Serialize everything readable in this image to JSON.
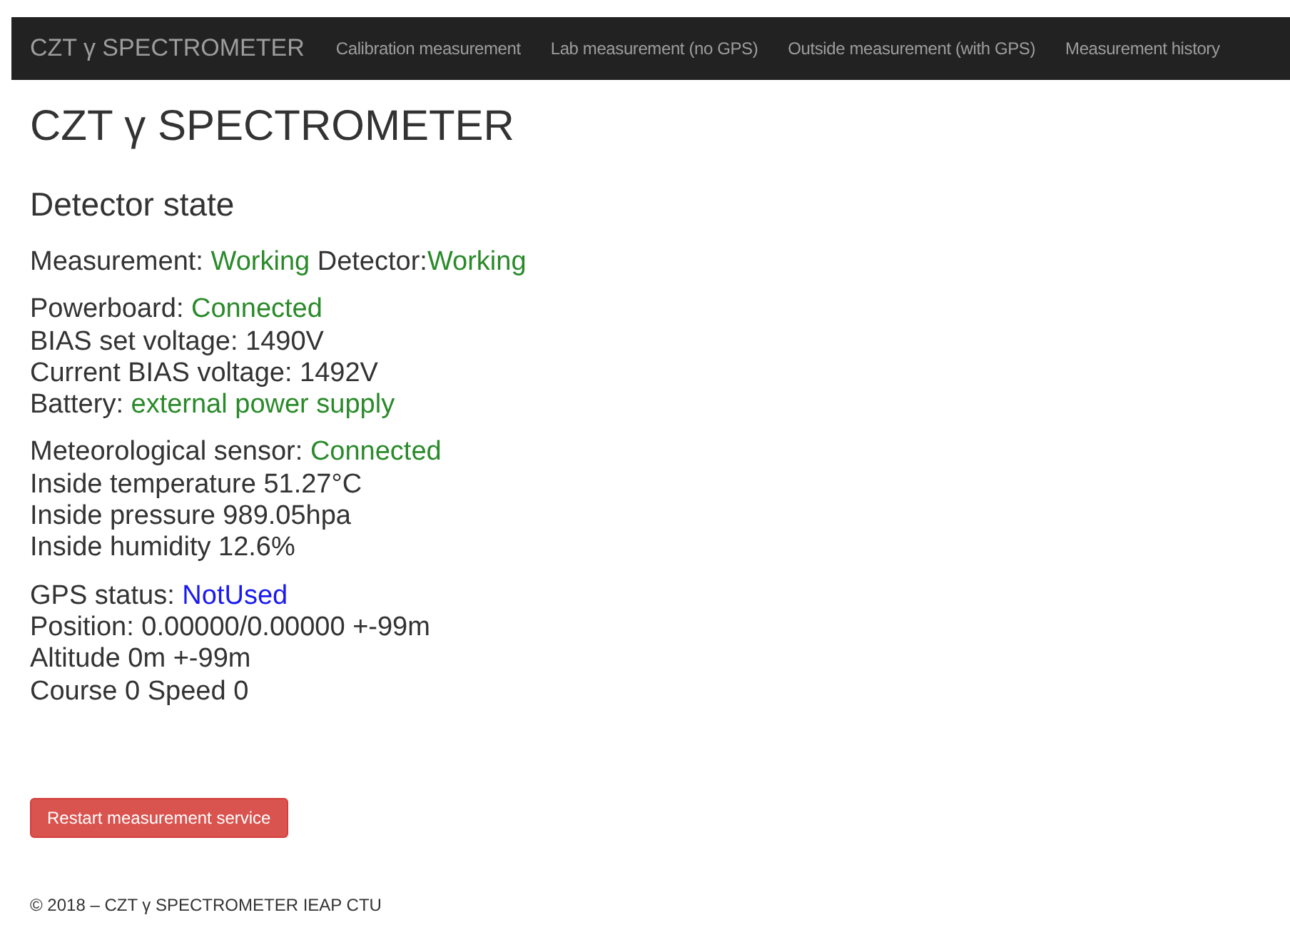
{
  "navbar": {
    "brand": "CZT γ SPECTROMETER",
    "links": [
      {
        "label": "Calibration measurement"
      },
      {
        "label": "Lab measurement (no GPS)"
      },
      {
        "label": "Outside measurement (with GPS)"
      },
      {
        "label": "Measurement history"
      }
    ]
  },
  "title": "CZT γ SPECTROMETER",
  "section_title": "Detector state",
  "groups": [
    {
      "lines": [
        {
          "segments": [
            {
              "text": "Measurement: "
            },
            {
              "text": "Working",
              "color": "#2a8a2a"
            },
            {
              "text": " Detector:"
            },
            {
              "text": "Working",
              "color": "#2a8a2a"
            }
          ]
        }
      ]
    },
    {
      "lines": [
        {
          "segments": [
            {
              "text": "Powerboard: "
            },
            {
              "text": "Connected",
              "color": "#2a8a2a"
            }
          ]
        },
        {
          "segments": [
            {
              "text": "BIAS set voltage: 1490V"
            }
          ]
        },
        {
          "segments": [
            {
              "text": "Current BIAS voltage: 1492V"
            }
          ]
        },
        {
          "segments": [
            {
              "text": "Battery: "
            },
            {
              "text": "external power supply",
              "color": "#2a8a2a"
            }
          ]
        }
      ]
    },
    {
      "lines": [
        {
          "segments": [
            {
              "text": "Meteorological sensor: "
            },
            {
              "text": "Connected",
              "color": "#2a8a2a"
            }
          ]
        },
        {
          "segments": [
            {
              "text": "Inside temperature 51.27°C"
            }
          ]
        },
        {
          "segments": [
            {
              "text": "Inside pressure 989.05hpa"
            }
          ]
        },
        {
          "segments": [
            {
              "text": "Inside humidity 12.6%"
            }
          ]
        }
      ]
    },
    {
      "lines": [
        {
          "segments": [
            {
              "text": "GPS status: "
            },
            {
              "text": "NotUsed",
              "color": "#1a1aee"
            }
          ]
        },
        {
          "segments": [
            {
              "text": "Position: 0.00000/0.00000 +-99m"
            }
          ]
        },
        {
          "segments": [
            {
              "text": "Altitude 0m +-99m"
            }
          ]
        },
        {
          "segments": [
            {
              "text": "Course 0 Speed 0"
            }
          ]
        }
      ]
    }
  ],
  "button": "Restart measurement service",
  "footer": "© 2018 – CZT γ SPECTROMETER IEAP CTU"
}
